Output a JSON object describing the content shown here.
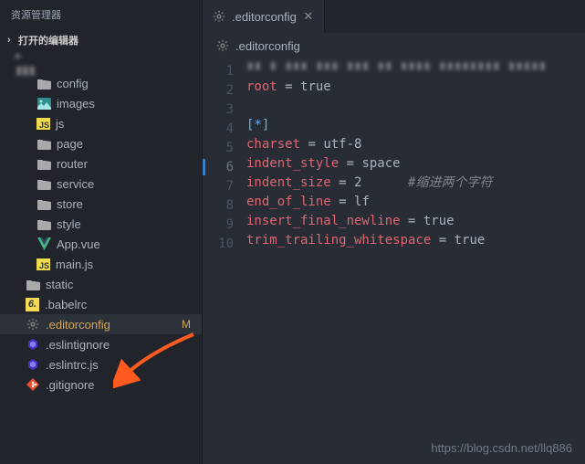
{
  "sidebar": {
    "title": "资源管理器",
    "open_editors_label": "打开的编辑器",
    "root_name": "project",
    "items": [
      {
        "label": "config",
        "icon": "folder",
        "depth": 1
      },
      {
        "label": "images",
        "icon": "image",
        "depth": 1
      },
      {
        "label": "js",
        "icon": "js",
        "depth": 1
      },
      {
        "label": "page",
        "icon": "folder",
        "depth": 1
      },
      {
        "label": "router",
        "icon": "folder",
        "depth": 1
      },
      {
        "label": "service",
        "icon": "folder",
        "depth": 1
      },
      {
        "label": "store",
        "icon": "folder",
        "depth": 1
      },
      {
        "label": "style",
        "icon": "folder",
        "depth": 1
      },
      {
        "label": "App.vue",
        "icon": "vue",
        "depth": 1
      },
      {
        "label": "main.js",
        "icon": "js",
        "depth": 1
      },
      {
        "label": "static",
        "icon": "folder",
        "depth": 0
      },
      {
        "label": ".babelrc",
        "icon": "babel",
        "depth": 0
      },
      {
        "label": ".editorconfig",
        "icon": "gear",
        "depth": 0,
        "selected": true,
        "status": "M"
      },
      {
        "label": ".eslintignore",
        "icon": "eslint",
        "depth": 0
      },
      {
        "label": ".eslintrc.js",
        "icon": "eslint",
        "depth": 0
      },
      {
        "label": ".gitignore",
        "icon": "git",
        "depth": 0
      }
    ]
  },
  "tab": {
    "label": ".editorconfig"
  },
  "breadcrumb": {
    "label": ".editorconfig"
  },
  "code": {
    "current_line": 6,
    "comment": "#缩进两个字符",
    "lines": [
      {
        "num": 1,
        "key": "root",
        "op": " = ",
        "val": "true"
      },
      {
        "num": 2
      },
      {
        "num": 3,
        "section": "[*]"
      },
      {
        "num": 4,
        "key": "charset",
        "op": " = ",
        "val": "utf-8"
      },
      {
        "num": 5,
        "key": "indent_style",
        "op": " = ",
        "val": "space"
      },
      {
        "num": 6,
        "key": "indent_size",
        "op": " = ",
        "val": "2",
        "has_comment": true
      },
      {
        "num": 7,
        "key": "end_of_line",
        "op": " = ",
        "val": "lf"
      },
      {
        "num": 8,
        "key": "insert_final_newline",
        "op": " = ",
        "val": "true"
      },
      {
        "num": 9,
        "key": "trim_trailing_whitespace",
        "op": " = ",
        "val": "true"
      },
      {
        "num": 10
      }
    ]
  },
  "watermark": "https://blog.csdn.net/llq886"
}
